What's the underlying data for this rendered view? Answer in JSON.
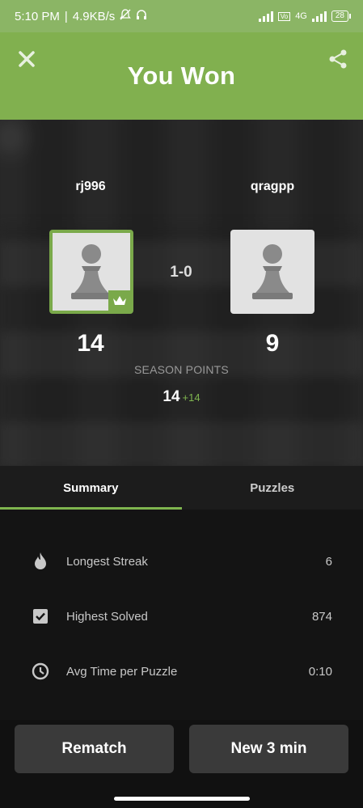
{
  "status_bar": {
    "time": "5:10 PM",
    "speed": "4.9KB/s",
    "network": "4G",
    "battery": "28"
  },
  "header": {
    "title": "You Won"
  },
  "players": {
    "left": {
      "name": "rj996",
      "rating": "14",
      "winner": true
    },
    "right": {
      "name": "qragpp",
      "rating": "9",
      "winner": false
    }
  },
  "result": "1-0",
  "season": {
    "label": "SEASON POINTS",
    "points": "14",
    "delta": "+14"
  },
  "tabs": [
    {
      "label": "Summary",
      "active": true
    },
    {
      "label": "Puzzles",
      "active": false
    }
  ],
  "summary": {
    "rows": [
      {
        "icon": "flame-icon",
        "label": "Longest Streak",
        "value": "6"
      },
      {
        "icon": "checkbox-icon",
        "label": "Highest Solved",
        "value": "874"
      },
      {
        "icon": "clock-icon",
        "label": "Avg Time per Puzzle",
        "value": "0:10"
      }
    ]
  },
  "buttons": {
    "rematch": "Rematch",
    "new_game": "New 3 min"
  },
  "colors": {
    "accent": "#81b04f",
    "winner_border": "#7aa94a",
    "delta": "#7fb54f"
  }
}
